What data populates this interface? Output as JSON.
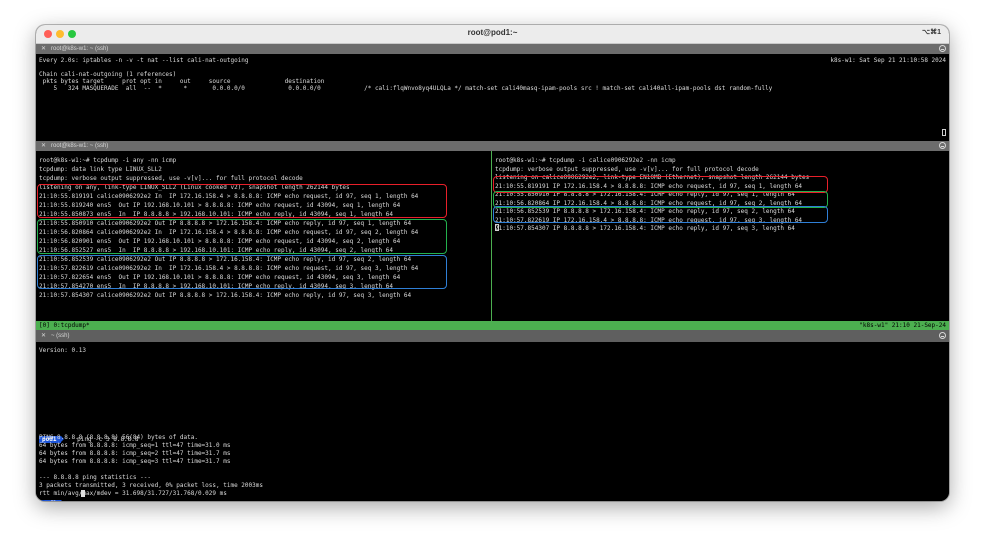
{
  "window": {
    "title": "root@pod1:~",
    "shortcut": "⌥⌘1",
    "colors": {
      "close": "#ff5f57",
      "minimize": "#febc2e",
      "zoom": "#28c840",
      "status_green": "#4caf50",
      "prompt_blue": "#1e56d9",
      "box_red": "#e8202a",
      "box_green": "#23b14d",
      "box_blue": "#2f7fd6"
    }
  },
  "pane1": {
    "tab": "root@k8s-w1: ~ (ssh)",
    "lines": [
      "Every 2.0s: iptables -n -v -t nat --list cali-nat-outgoing",
      "",
      "Chain cali-nat-outgoing (1 references)",
      " pkts bytes target     prot opt in     out     source               destination",
      "    5   324 MASQUERADE  all  --  *      *       0.0.0.0/0            0.0.0.0/0            /* cali:flqWnvo8yq4ULQLa */ match-set cali40masq-ipam-pools src ! match-set cali40all-ipam-pools dst random-fully"
    ],
    "right_status": "k8s-w1: Sat Sep 21 21:10:58 2024"
  },
  "pane2": {
    "tab": "root@k8s-w1: ~ (ssh)",
    "left_lines": [
      "root@k8s-w1:~# tcpdump -i any -nn icmp",
      "tcpdump: data link type LINUX_SLL2",
      "tcpdump: verbose output suppressed, use -v[v]... for full protocol decode",
      "listening on any, link-type LINUX_SLL2 (Linux cooked v2), snapshot length 262144 bytes",
      "21:10:55.819191 calice0906292e2 In  IP 172.16.158.4 > 8.8.8.8: ICMP echo request, id 97, seq 1, length 64",
      "21:10:55.819240 ens5  Out IP 192.168.10.101 > 8.8.8.8: ICMP echo request, id 43094, seq 1, length 64",
      "21:10:55.850873 ens5  In  IP 8.8.8.8 > 192.168.10.101: ICMP echo reply, id 43094, seq 1, length 64",
      "21:10:55.850910 calice0906292e2 Out IP 8.8.8.8 > 172.16.158.4: ICMP echo reply, id 97, seq 1, length 64",
      "21:10:56.820864 calice0906292e2 In  IP 172.16.158.4 > 8.8.8.8: ICMP echo request, id 97, seq 2, length 64",
      "21:10:56.820901 ens5  Out IP 192.168.10.101 > 8.8.8.8: ICMP echo request, id 43094, seq 2, length 64",
      "21:10:56.852527 ens5  In  IP 8.8.8.8 > 192.168.10.101: ICMP echo reply, id 43094, seq 2, length 64",
      "21:10:56.852539 calice0906292e2 Out IP 8.8.8.8 > 172.16.158.4: ICMP echo reply, id 97, seq 2, length 64",
      "21:10:57.822619 calice0906292e2 In  IP 172.16.158.4 > 8.8.8.8: ICMP echo request, id 97, seq 3, length 64",
      "21:10:57.822654 ens5  Out IP 192.168.10.101 > 8.8.8.8: ICMP echo request, id 43094, seq 3, length 64",
      "21:10:57.854270 ens5  In  IP 8.8.8.8 > 192.168.10.101: ICMP echo reply, id 43094, seq 3, length 64",
      "21:10:57.854307 calice0906292e2 Out IP 8.8.8.8 > 172.16.158.4: ICMP echo reply, id 97, seq 3, length 64"
    ],
    "right_lines": [
      "root@k8s-w1:~# tcpdump -i calice0906292e2 -nn icmp",
      "tcpdump: verbose output suppressed, use -v[v]... for full protocol decode",
      "listening on calice0906292e2, link-type EN10MB (Ethernet), snapshot length 262144 bytes",
      "21:10:55.819191 IP 172.16.158.4 > 8.8.8.8: ICMP echo request, id 97, seq 1, length 64",
      "21:10:55.850910 IP 8.8.8.8 > 172.16.158.4: ICMP echo reply, id 97, seq 1, length 64",
      "21:10:56.820864 IP 172.16.158.4 > 8.8.8.8: ICMP echo request, id 97, seq 2, length 64",
      "21:10:56.852539 IP 8.8.8.8 > 172.16.158.4: ICMP echo reply, id 97, seq 2, length 64",
      "21:10:57.822619 IP 172.16.158.4 > 8.8.8.8: ICMP echo request, id 97, seq 3, length 64",
      "21:10:57.854307 IP 8.8.8.8 > 172.16.158.4: ICMP echo reply, id 97, seq 3, length 64"
    ]
  },
  "statusbar": {
    "left": "[0] 0:tcpdump*",
    "right": "\"k8s-w1\" 21:10 21-Sep-24"
  },
  "pane3": {
    "tab": "~ (ssh)",
    "version": "Version: 0.13",
    "prompt_host": "pod1",
    "command": "ping -c 3 8.8.8.8",
    "output": [
      "PING 8.8.8.8 (8.8.8.8) 56(84) bytes of data.",
      "64 bytes from 8.8.8.8: icmp_seq=1 ttl=47 time=31.0 ms",
      "64 bytes from 8.8.8.8: icmp_seq=2 ttl=47 time=31.7 ms",
      "64 bytes from 8.8.8.8: icmp_seq=3 ttl=47 time=31.7 ms",
      "",
      "--- 8.8.8.8 ping statistics ---",
      "3 packets transmitted, 3 received, 0% packet loss, time 2003ms",
      "rtt min/avg/max/mdev = 31.698/31.727/31.768/0.029 ms"
    ]
  }
}
